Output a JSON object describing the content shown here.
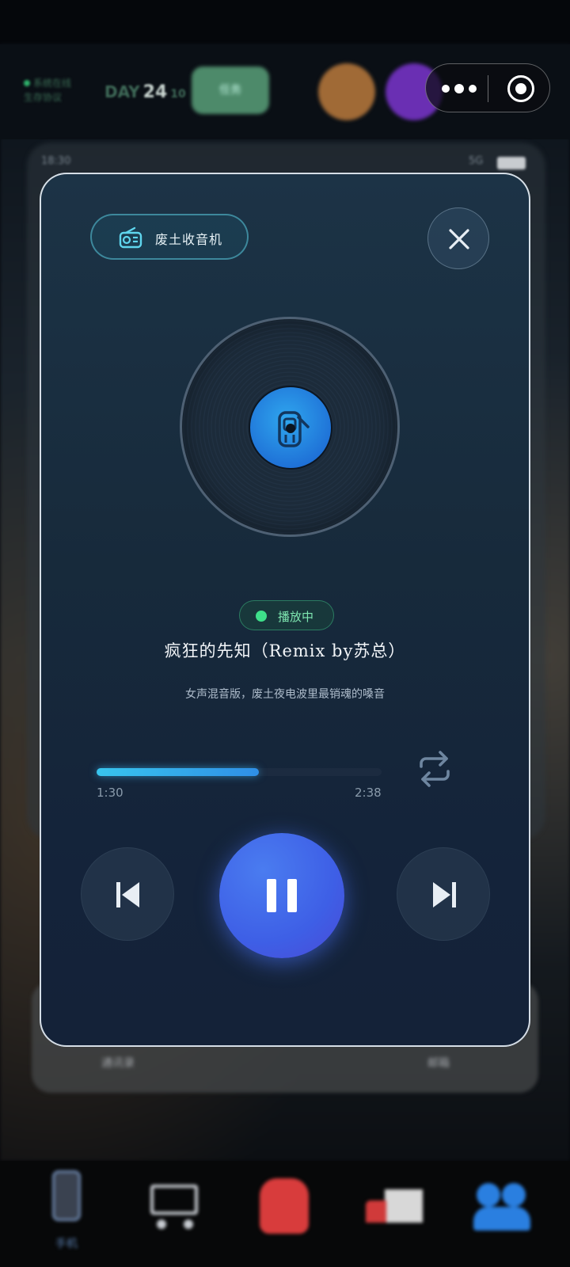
{
  "background": {
    "status_line1": "系统在线",
    "status_line2": "生存协议",
    "day_label": "DAY",
    "day_value": "24",
    "day_extra": "10",
    "task_label": "任务",
    "phone_time": "18:30",
    "phone_signal": "5G",
    "dock_labels": [
      "通讯录",
      "邮箱"
    ],
    "nav_labels": [
      "手机"
    ]
  },
  "player": {
    "badge_label": "废土收音机",
    "status_label": "播放中",
    "title": "疯狂的先知（Remix by苏总）",
    "description": "女声混音版，废土夜电波里最销魂的嗓音",
    "current_time": "1:30",
    "total_time": "2:38",
    "progress": 0.57,
    "state": "playing",
    "accent_color": "#3e5fe6",
    "progress_color": "#38c5ee",
    "status_color": "#3ee08a"
  },
  "icons": [
    "radio-icon",
    "close-icon",
    "vinyl-label-icon",
    "repeat-icon",
    "previous-icon",
    "pause-icon",
    "next-icon",
    "more-dots-icon",
    "target-icon"
  ]
}
